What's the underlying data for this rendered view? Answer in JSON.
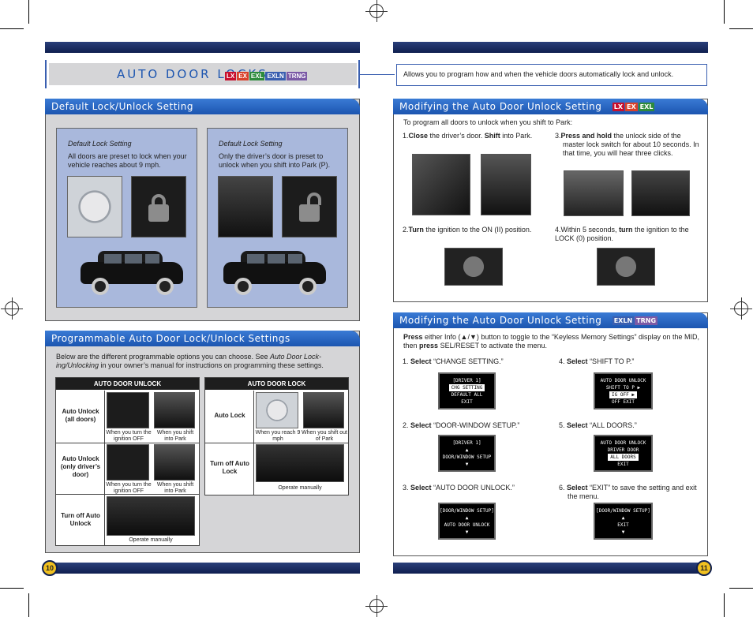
{
  "left_page": {
    "title": "AUTO DOOR LOCKS",
    "title_badges": [
      "LX",
      "EX",
      "EXL",
      "EXLN",
      "TRNG"
    ],
    "default_section": {
      "heading": "Default Lock/Unlock Setting",
      "box1_caption": "Default Lock Setting",
      "box1_text": "All doors are preset to lock when your vehicle reaches about 9 mph.",
      "box2_caption": "Default Lock Setting",
      "box2_text": "Only the driver’s door is preset to unlock when you shift into Park (P)."
    },
    "programmable_section": {
      "heading": "Programmable Auto Door Lock/Unlock Settings",
      "intro_pre": "Below are the different programmable options you can choose. See ",
      "intro_italic": "Auto Door Lock-ing/Unlocking",
      "intro_post": " in your owner’s manual for instructions on programming these settings.",
      "unlock_table": {
        "header": "AUTO DOOR UNLOCK",
        "rows": [
          {
            "label": "Auto Unlock (all doors)",
            "cap1": "When you turn the ignition OFF",
            "cap2": "When you shift into Park"
          },
          {
            "label": "Auto Unlock (only driver’s door)",
            "cap1": "When you turn the ignition OFF",
            "cap2": "When you shift into Park"
          },
          {
            "label": "Turn off Auto Unlock",
            "cap1": "Operate manually"
          }
        ]
      },
      "lock_table": {
        "header": "AUTO DOOR LOCK",
        "rows": [
          {
            "label": "Auto Lock",
            "cap1": "When you reach 9 mph",
            "cap2": "When you shift out of Park"
          },
          {
            "label": "Turn off Auto Lock",
            "cap1": "Operate manually"
          }
        ]
      }
    },
    "page_number": "10"
  },
  "right_page": {
    "intro": "Allows you to program how and when the vehicle doors automatically lock and unlock.",
    "section1": {
      "heading": "Modifying the Auto Door Unlock Setting",
      "badges": [
        "LX",
        "EX",
        "EXL"
      ],
      "lead": "To program all doors to unlock when you shift to Park:",
      "step1_num": "1.",
      "step1_b1": "Close",
      "step1_t1": " the driver’s door. ",
      "step1_b2": "Shift",
      "step1_t2": " into Park.",
      "step2_num": "2.",
      "step2_b": "Turn",
      "step2_t": " the ignition to the ON (II) position.",
      "step3_num": "3.",
      "step3_b1": "Press and hold",
      "step3_t1": " the unlock side of the master lock switch for about 10 seconds. In that time, you will hear three clicks.",
      "step4_num": "4.",
      "step4_t1": "Within 5 seconds, ",
      "step4_b": "turn",
      "step4_t2": " the ignition to the LOCK (0) position."
    },
    "section2": {
      "heading": "Modifying the Auto Door Unlock Setting",
      "badges": [
        "EXLN",
        "TRNG"
      ],
      "lead_b1": "Press",
      "lead_t1": " either Info (▲/▼) button to toggle to the “Keyless Memory Settings” display on the MID, then ",
      "lead_b2": "press",
      "lead_t2": " SEL/RESET to activate the menu.",
      "steps": [
        {
          "num": "1.",
          "verb": "Select",
          "text": " “CHANGE SETTING.”",
          "screen": [
            "[DRIVER 1]",
            "CHG SETTING",
            "DEFAULT ALL",
            "EXIT"
          ],
          "sel": 1
        },
        {
          "num": "2.",
          "verb": "Select",
          "text": " “DOOR-WINDOW SETUP.”",
          "screen": [
            "[DRIVER 1]",
            "▲",
            "DOOR/WINDOW SETUP",
            "▼"
          ],
          "sel": -1
        },
        {
          "num": "3.",
          "verb": "Select",
          "text": " “AUTO DOOR UNLOCK.”",
          "screen": [
            "[DOOR/WINDOW SETUP]",
            "▲",
            "AUTO DOOR UNLOCK",
            "▼"
          ],
          "sel": -1
        },
        {
          "num": "4.",
          "verb": "Select",
          "text": " “SHIFT TO P.”",
          "screen": [
            "AUTO DOOR UNLOCK",
            "SHIFT TO P ▶",
            "IG OFF ▶",
            "OFF  EXIT"
          ],
          "sel": 2
        },
        {
          "num": "5.",
          "verb": "Select",
          "text": " “ALL DOORS.”",
          "screen": [
            "AUTO DOOR UNLOCK",
            "DRIVER DOOR",
            "ALL DOORS",
            "EXIT"
          ],
          "sel": 2
        },
        {
          "num": "6.",
          "verb": "Select",
          "text": " “EXIT” to save the setting and exit the menu.",
          "screen": [
            "[DOOR/WINDOW SETUP]",
            "▲",
            "EXIT",
            "▼"
          ],
          "sel": -1
        }
      ]
    },
    "page_number": "11"
  },
  "colors": {
    "navy_bar": "#0f1f4f",
    "tab_blue": "#1c55b0",
    "box_blue": "#a9b8dc",
    "panel_gray": "#d5d5d7"
  }
}
